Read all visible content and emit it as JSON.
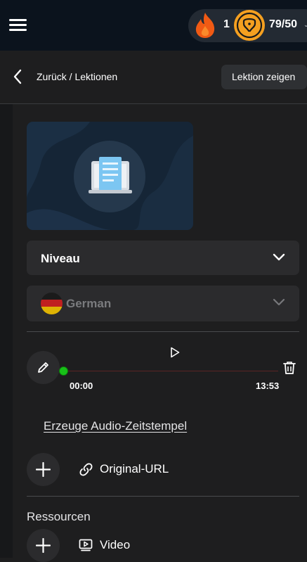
{
  "header": {
    "menu_icon": "hamburger-menu-icon",
    "streak_icon": "flame-icon",
    "streak_count": "1",
    "score_icon": "badge-icon",
    "score": "79/50",
    "score_chevron": "⌄",
    "colors": {
      "background": "#0b131d",
      "pill": "#232a33",
      "flame": "#f05a14",
      "badge": "#f5a020"
    }
  },
  "nav": {
    "back_icon": "chevron-left-icon",
    "breadcrumb": "Zurück / Lektionen",
    "show_lesson_button": "Lektion zeigen"
  },
  "lesson": {
    "thumbnail_icon": "laptop-document-icon",
    "level_select": {
      "label": "Niveau",
      "icon": "chevron-down-icon"
    },
    "language_select": {
      "label": "German",
      "flag_icon": "germany-flag-icon",
      "icon": "chevron-down-icon"
    }
  },
  "audio": {
    "edit_icon": "pencil-icon",
    "play_icon": "play-icon",
    "delete_icon": "trash-icon",
    "time_start": "00:00",
    "time_end": "13:53",
    "progress": 0,
    "timestamp_link": "Erzeuge Audio-Zeitstempel"
  },
  "original_url": {
    "add_icon": "plus-icon",
    "link_icon": "link-icon",
    "label": "Original-URL"
  },
  "resources": {
    "heading": "Ressourcen",
    "video": {
      "add_icon": "plus-icon",
      "icon": "video-icon",
      "label": "Video"
    }
  },
  "colors": {
    "page": "#1e1e1f",
    "panel": "#2b2b2d",
    "accent_green": "#18c018"
  }
}
